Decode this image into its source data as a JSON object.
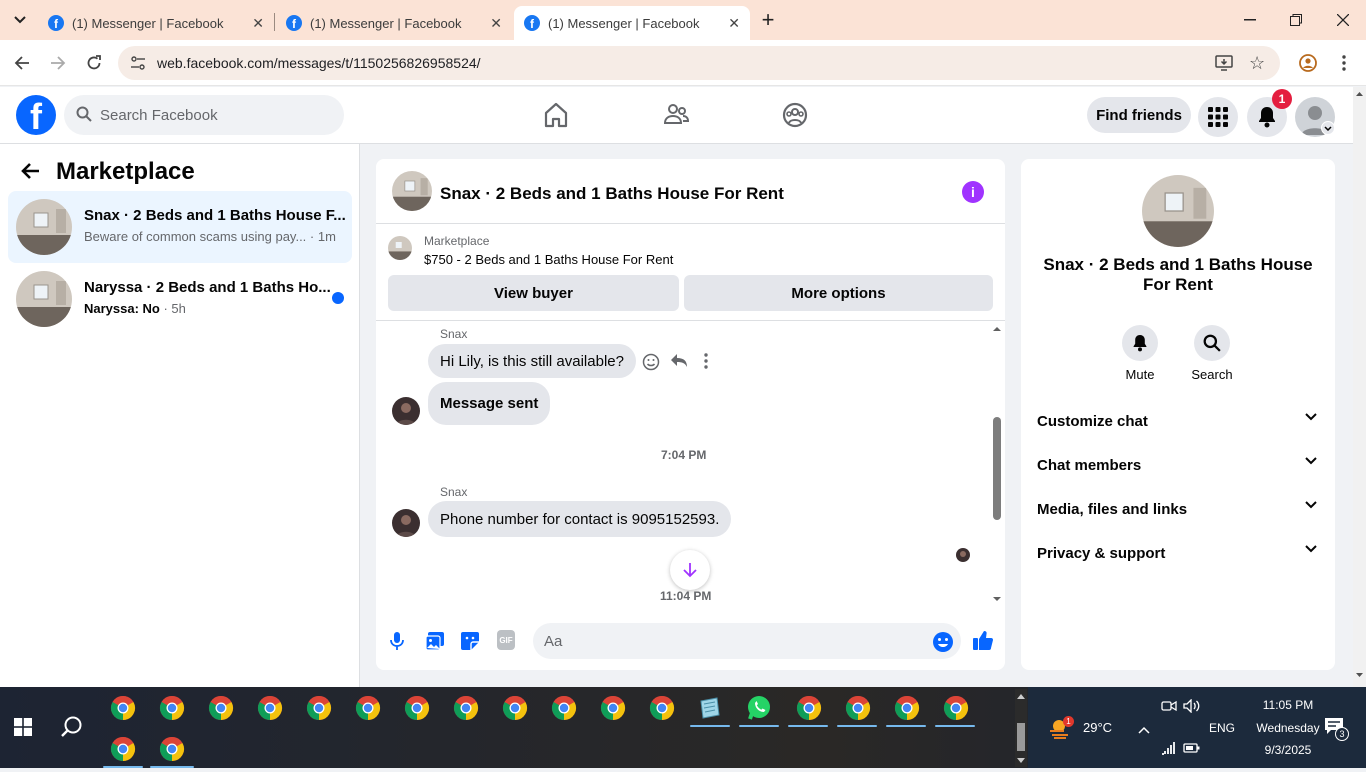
{
  "browser": {
    "tabs": [
      {
        "title": "(1) Messenger | Facebook"
      },
      {
        "title": "(1) Messenger | Facebook"
      },
      {
        "title": "(1) Messenger | Facebook"
      }
    ],
    "url": "web.facebook.com/messages/t/1150256826958524/"
  },
  "header": {
    "logo": "f",
    "search_placeholder": "Search Facebook",
    "find_friends": "Find friends",
    "notification_count": "1"
  },
  "sidebar": {
    "title": "Marketplace",
    "conversations": [
      {
        "title": "Snax · 2 Beds and 1 Baths House F...",
        "preview": "Beware of common scams using pay...",
        "time": " · 1m",
        "selected": true
      },
      {
        "title": "Naryssa · 2 Beds and 1 Baths Ho...",
        "preview_bold": "Naryssa: No",
        "time": " · 5h",
        "unread": true
      }
    ]
  },
  "chat": {
    "title": "Snax · 2 Beds and 1 Baths House For Rent",
    "listing_label": "Marketplace",
    "listing_price": "$750 - 2 Beds and 1 Baths House For Rent",
    "view_buyer": "View buyer",
    "more_options": "More options",
    "messages": [
      {
        "sender": "Snax",
        "text": "Hi Lily, is this still available?"
      },
      {
        "text": "Message sent"
      },
      {
        "timestamp": "7:04 PM"
      },
      {
        "sender": "Snax",
        "text": "Phone number for contact is 9095152593."
      },
      {
        "timestamp": "11:04 PM"
      }
    ],
    "composer_placeholder": "Aa"
  },
  "details": {
    "title": "Snax · 2 Beds and 1 Baths House For Rent",
    "actions": [
      {
        "label": "Mute"
      },
      {
        "label": "Search"
      }
    ],
    "sections": [
      "Customize chat",
      "Chat members",
      "Media, files and links",
      "Privacy & support"
    ]
  },
  "taskbar": {
    "weather": "29°C",
    "weather_badge": "1",
    "language": "ENG",
    "time": "11:05 PM",
    "day": "Wednesday",
    "date": "9/3/2025",
    "notification_count": "3"
  },
  "colors": {
    "accent": "#0866ff",
    "info_purple": "#a033ff",
    "tabstrip": "#fbe3d6"
  }
}
